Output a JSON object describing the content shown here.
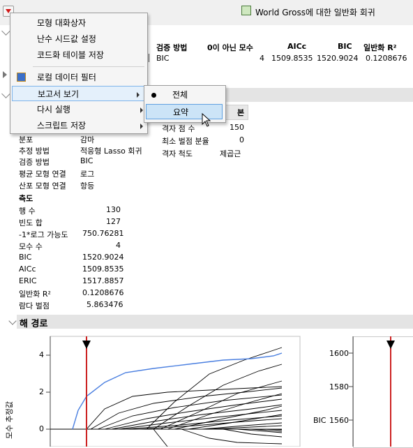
{
  "window": {
    "title": "World  Gross에 대한 일반화 회귀"
  },
  "model_table": {
    "headers": [
      "검증 방법",
      "0이 아닌 모수",
      "AICc",
      "BIC",
      "일반화 R²"
    ],
    "row": [
      "BIC",
      "4",
      "1509.8535",
      "1520.9024",
      "0.1208676"
    ]
  },
  "context_menu": {
    "items": [
      "모형 대화상자",
      "난수 시드값 설정",
      "코드화 테이블 저장",
      "로컬 데이터 필터",
      "보고서 보기",
      "다시 실행",
      "스크립트 저장"
    ]
  },
  "submenu": {
    "items": [
      "전체",
      "요약"
    ],
    "checked": "전체",
    "highlighted": "요약"
  },
  "grid_panel": {
    "header_fragment": "본",
    "rows": [
      {
        "label": "격자 점 수",
        "value": "150"
      },
      {
        "label": "최소 벌점 분율",
        "value": "0"
      },
      {
        "label": "격자 척도",
        "value": "제곱근"
      }
    ]
  },
  "spec_rows": [
    {
      "label": "분포",
      "value": "감마"
    },
    {
      "label": "추정 방법",
      "value": "적응형 Lasso 회귀"
    },
    {
      "label": "검증 방법",
      "value": "BIC"
    },
    {
      "label": "평균 모형 연결",
      "value": "로그"
    },
    {
      "label": "산포 모형 연결",
      "value": "항등"
    }
  ],
  "measures": {
    "title": "측도",
    "rows": [
      {
        "label": "행 수",
        "value": "130"
      },
      {
        "label": "빈도 합",
        "value": "127"
      },
      {
        "label": "-1*로그 가능도",
        "value": "750.76281"
      },
      {
        "label": "모수 수",
        "value": "4"
      },
      {
        "label": "BIC",
        "value": "1520.9024"
      },
      {
        "label": "AICc",
        "value": "1509.8535"
      },
      {
        "label": "ERIC",
        "value": "1517.8857"
      },
      {
        "label": "일반화 R²",
        "value": "0.1208676"
      },
      {
        "label": "람다 벌점",
        "value": "5.863476"
      }
    ]
  },
  "solution_path": {
    "title": "해 경로",
    "left_ylabel": "모수 추정값",
    "left_yticks": [
      "4",
      "2",
      "0"
    ],
    "right_ylabel": "BIC",
    "right_yticks": [
      "1600",
      "1580",
      "1560"
    ]
  },
  "colors": {
    "highlight": "#cce4f7",
    "red_marker": "#cc2222",
    "blue_path": "#4a7fe0"
  }
}
